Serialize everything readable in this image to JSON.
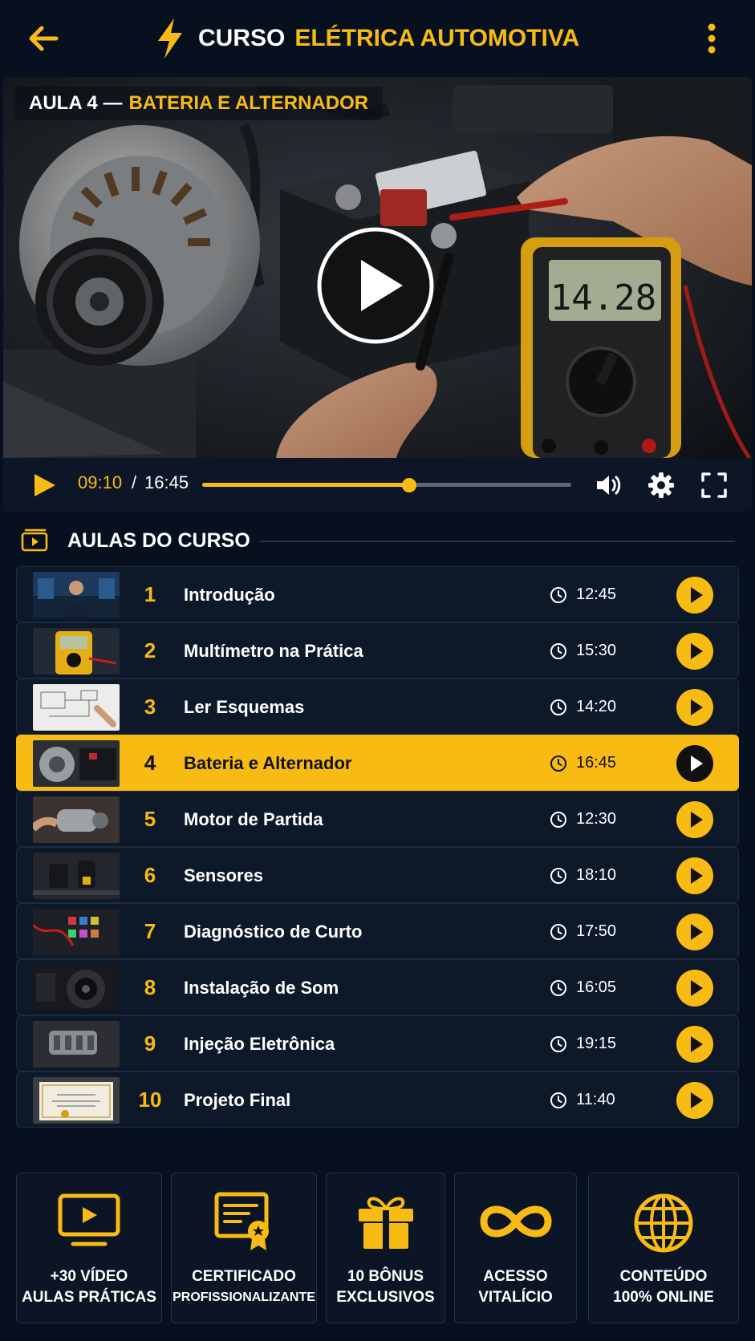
{
  "header": {
    "title_white": "CURSO",
    "title_accent": "ELÉTRICA AUTOMOTIVA",
    "back_icon": "arrow-left-icon",
    "menu_icon": "more-vertical-icon",
    "logo_icon": "lightning-bolt-icon"
  },
  "video": {
    "tag_prefix": "AULA 4 —",
    "tag_title": "BATERIA E ALTERNADOR",
    "multimeter_reading": "14.28",
    "current_time": "09:10",
    "separator": "/",
    "total_time": "16:45",
    "progress_fraction": 0.56
  },
  "lessons_section": {
    "title": "AULAS DO CURSO",
    "items": [
      {
        "number": "1",
        "title": "Introdução",
        "duration": "12:45",
        "active": false
      },
      {
        "number": "2",
        "title": "Multímetro na Prática",
        "duration": "15:30",
        "active": false
      },
      {
        "number": "3",
        "title": "Ler Esquemas",
        "duration": "14:20",
        "active": false
      },
      {
        "number": "4",
        "title": "Bateria e Alternador",
        "duration": "16:45",
        "active": true
      },
      {
        "number": "5",
        "title": "Motor de Partida",
        "duration": "12:30",
        "active": false
      },
      {
        "number": "6",
        "title": "Sensores",
        "duration": "18:10",
        "active": false
      },
      {
        "number": "7",
        "title": "Diagnóstico de Curto",
        "duration": "17:50",
        "active": false
      },
      {
        "number": "8",
        "title": "Instalação de Som",
        "duration": "16:05",
        "active": false
      },
      {
        "number": "9",
        "title": "Injeção Eletrônica",
        "duration": "19:15",
        "active": false
      },
      {
        "number": "10",
        "title": "Projeto Final",
        "duration": "11:40",
        "active": false
      }
    ]
  },
  "features": [
    {
      "icon": "video-screen-icon",
      "line1": "+30 VÍDEO",
      "line2": "AULAS PRÁTICAS"
    },
    {
      "icon": "certificate-icon",
      "line1": "CERTIFICADO",
      "line2": "PROFISSIONALIZANTE"
    },
    {
      "icon": "gift-icon",
      "line1": "10 BÔNUS",
      "line2": "EXCLUSIVOS"
    },
    {
      "icon": "infinity-icon",
      "line1": "ACESSO",
      "line2": "VITALÍCIO"
    },
    {
      "icon": "globe-icon",
      "line1": "CONTEÚDO",
      "line2": "100% ONLINE"
    }
  ],
  "colors": {
    "accent": "#f8bb13",
    "background": "#07101f",
    "card": "#0d1829"
  }
}
